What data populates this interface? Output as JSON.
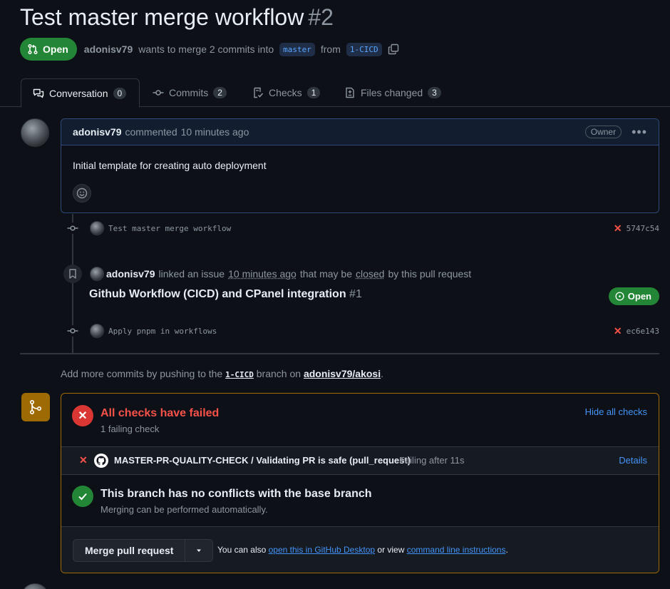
{
  "pr": {
    "title": "Test master merge workflow",
    "number": "#2",
    "state": "Open",
    "author": "adonisv79",
    "merge_text": "wants to merge 2 commits into",
    "base_branch": "master",
    "from_text": "from",
    "head_branch": "1-CICD"
  },
  "tabs": [
    {
      "label": "Conversation",
      "count": "0"
    },
    {
      "label": "Commits",
      "count": "2"
    },
    {
      "label": "Checks",
      "count": "1"
    },
    {
      "label": "Files changed",
      "count": "3"
    }
  ],
  "comment": {
    "author": "adonisv79",
    "action": "commented",
    "time": "10 minutes ago",
    "badge": "Owner",
    "body": "Initial template for creating auto deployment"
  },
  "timeline": {
    "commit1": {
      "message": "Test master merge workflow",
      "sha": "5747c54"
    },
    "linked": {
      "author": "adonisv79",
      "text1": "linked an issue",
      "time": "10 minutes ago",
      "text2": "that may be",
      "closed": "closed",
      "text3": "by this pull request",
      "issue_title": "Github Workflow (CICD) and CPanel integration",
      "issue_number": "#1",
      "issue_state": "Open"
    },
    "commit2": {
      "message": "Apply pnpm in workflows",
      "sha": "ec6e143"
    }
  },
  "hint": {
    "prefix": "Add more commits by pushing to the",
    "branch": "1-CICD",
    "middle": "branch on",
    "repo": "adonisv79/akosi",
    "suffix": "."
  },
  "checks": {
    "title": "All checks have failed",
    "subtitle": "1 failing check",
    "toggle_label": "Hide all checks",
    "item_name": "MASTER-PR-QUALITY-CHECK / Validating PR is safe (pull_request)",
    "item_status": "Failing after 11s",
    "item_details": "Details"
  },
  "conflicts": {
    "title": "This branch has no conflicts with the base branch",
    "subtitle": "Merging can be performed automatically."
  },
  "merge": {
    "button_label": "Merge pull request",
    "also_text": "You can also",
    "desktop_link": "open this in GitHub Desktop",
    "or_view": "or view",
    "cli_link": "command line instructions",
    "end": "."
  },
  "colors": {
    "open_green": "#238636",
    "fail_red": "#da3633",
    "warning_border": "#9e6a03",
    "link_blue": "#4493f8"
  }
}
